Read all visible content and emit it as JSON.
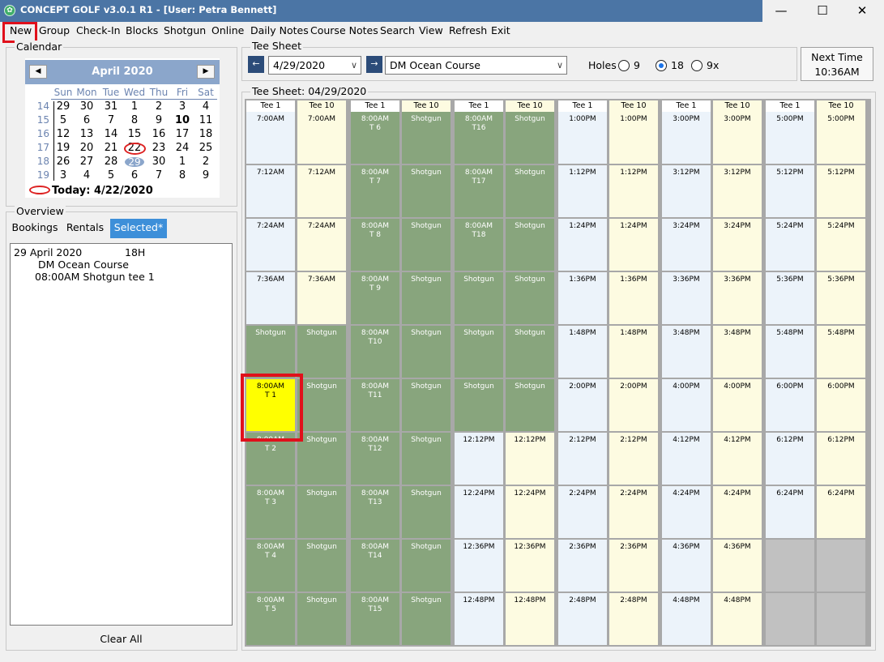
{
  "window": {
    "title": "CONCEPT GOLF v3.0.1 R1 - [User: Petra Bennett]",
    "app_icon": "golf-ball-icon",
    "controls": {
      "minimize": "—",
      "maximize": "☐",
      "close": "✕"
    }
  },
  "menu": [
    "New",
    "Group",
    "Check-In",
    "Blocks",
    "Shotgun",
    "Online",
    "Daily Notes",
    "Course Notes",
    "Search",
    "View",
    "Refresh",
    "Exit"
  ],
  "calendar": {
    "section_label": "Calendar",
    "month_label": "April 2020",
    "prev": "◀",
    "next": "▶",
    "dow": [
      "Sun",
      "Mon",
      "Tue",
      "Wed",
      "Thu",
      "Fri",
      "Sat"
    ],
    "weeks": [
      {
        "week": "14",
        "days": [
          "29",
          "30",
          "31",
          "1",
          "2",
          "3",
          "4"
        ]
      },
      {
        "week": "15",
        "days": [
          "5",
          "6",
          "7",
          "8",
          "9",
          "10",
          "11"
        ]
      },
      {
        "week": "16",
        "days": [
          "12",
          "13",
          "14",
          "15",
          "16",
          "17",
          "18"
        ]
      },
      {
        "week": "17",
        "days": [
          "19",
          "20",
          "21",
          "22",
          "23",
          "24",
          "25"
        ]
      },
      {
        "week": "18",
        "days": [
          "26",
          "27",
          "28",
          "29",
          "30",
          "1",
          "2"
        ]
      },
      {
        "week": "19",
        "days": [
          "3",
          "4",
          "5",
          "6",
          "7",
          "8",
          "9"
        ]
      }
    ],
    "today_label": "Today: 4/22/2020",
    "today_day": "22",
    "selected_day": "29",
    "bold_day": "10"
  },
  "overview": {
    "section_label": "Overview",
    "tabs": [
      "Bookings",
      "Rentals",
      "Selected*"
    ],
    "active_tab": "Selected*",
    "lines": [
      "29 April 2020",
      "18H",
      "DM Ocean Course",
      "08:00AM Shotgun tee 1"
    ],
    "clear_all": "Clear All"
  },
  "tee_sheet_header": {
    "section_label": "Tee Sheet",
    "prev_date": "←",
    "date": "4/29/2020",
    "next_date": "→",
    "course": "DM Ocean Course",
    "holes_label": "Holes",
    "holes_options": [
      "9",
      "18",
      "9x"
    ],
    "holes_selected": "18",
    "next_time_label": "Next Time",
    "next_time": "10:36AM"
  },
  "tee_sheet": {
    "label": "Tee Sheet: 04/29/2020",
    "colors": {
      "tee1": "#ecf3fa",
      "tee10": "#fdfbe1",
      "shotgun": "#88a57d",
      "empty": "#c1c1c1",
      "selected": "#ffff00"
    },
    "groups": [
      {
        "headers": [
          "Tee 1",
          "Tee 10"
        ],
        "rows": [
          [
            {
              "t": "7:00AM",
              "k": "tee1"
            },
            {
              "t": "7:00AM",
              "k": "tee10"
            }
          ],
          [
            {
              "t": "7:12AM",
              "k": "tee1"
            },
            {
              "t": "7:12AM",
              "k": "tee10"
            }
          ],
          [
            {
              "t": "7:24AM",
              "k": "tee1"
            },
            {
              "t": "7:24AM",
              "k": "tee10"
            }
          ],
          [
            {
              "t": "7:36AM",
              "k": "tee1"
            },
            {
              "t": "7:36AM",
              "k": "tee10"
            }
          ],
          [
            {
              "t": "Shotgun",
              "k": "shotgun"
            },
            {
              "t": "Shotgun",
              "k": "shotgun"
            }
          ],
          [
            {
              "t": "8:00AM\nT 1",
              "k": "selected"
            },
            {
              "t": "Shotgun",
              "k": "shotgun"
            }
          ],
          [
            {
              "t": "8:00AM\nT 2",
              "k": "shotgun"
            },
            {
              "t": "Shotgun",
              "k": "shotgun"
            }
          ],
          [
            {
              "t": "8:00AM\nT 3",
              "k": "shotgun"
            },
            {
              "t": "Shotgun",
              "k": "shotgun"
            }
          ],
          [
            {
              "t": "8:00AM\nT 4",
              "k": "shotgun"
            },
            {
              "t": "Shotgun",
              "k": "shotgun"
            }
          ],
          [
            {
              "t": "8:00AM\nT 5",
              "k": "shotgun"
            },
            {
              "t": "Shotgun",
              "k": "shotgun"
            }
          ]
        ]
      },
      {
        "headers": [
          "Tee 1",
          "Tee 10"
        ],
        "rows": [
          [
            {
              "t": "8:00AM\nT 6",
              "k": "shotgun"
            },
            {
              "t": "Shotgun",
              "k": "shotgun"
            }
          ],
          [
            {
              "t": "8:00AM\nT 7",
              "k": "shotgun"
            },
            {
              "t": "Shotgun",
              "k": "shotgun"
            }
          ],
          [
            {
              "t": "8:00AM\nT 8",
              "k": "shotgun"
            },
            {
              "t": "Shotgun",
              "k": "shotgun"
            }
          ],
          [
            {
              "t": "8:00AM\nT 9",
              "k": "shotgun"
            },
            {
              "t": "Shotgun",
              "k": "shotgun"
            }
          ],
          [
            {
              "t": "8:00AM\nT10",
              "k": "shotgun"
            },
            {
              "t": "Shotgun",
              "k": "shotgun"
            }
          ],
          [
            {
              "t": "8:00AM\nT11",
              "k": "shotgun"
            },
            {
              "t": "Shotgun",
              "k": "shotgun"
            }
          ],
          [
            {
              "t": "8:00AM\nT12",
              "k": "shotgun"
            },
            {
              "t": "Shotgun",
              "k": "shotgun"
            }
          ],
          [
            {
              "t": "8:00AM\nT13",
              "k": "shotgun"
            },
            {
              "t": "Shotgun",
              "k": "shotgun"
            }
          ],
          [
            {
              "t": "8:00AM\nT14",
              "k": "shotgun"
            },
            {
              "t": "Shotgun",
              "k": "shotgun"
            }
          ],
          [
            {
              "t": "8:00AM\nT15",
              "k": "shotgun"
            },
            {
              "t": "Shotgun",
              "k": "shotgun"
            }
          ]
        ]
      },
      {
        "headers": [
          "Tee 1",
          "Tee 10"
        ],
        "rows": [
          [
            {
              "t": "8:00AM\nT16",
              "k": "shotgun"
            },
            {
              "t": "Shotgun",
              "k": "shotgun"
            }
          ],
          [
            {
              "t": "8:00AM\nT17",
              "k": "shotgun"
            },
            {
              "t": "Shotgun",
              "k": "shotgun"
            }
          ],
          [
            {
              "t": "8:00AM\nT18",
              "k": "shotgun"
            },
            {
              "t": "Shotgun",
              "k": "shotgun"
            }
          ],
          [
            {
              "t": "Shotgun",
              "k": "shotgun"
            },
            {
              "t": "Shotgun",
              "k": "shotgun"
            }
          ],
          [
            {
              "t": "Shotgun",
              "k": "shotgun"
            },
            {
              "t": "Shotgun",
              "k": "shotgun"
            }
          ],
          [
            {
              "t": "Shotgun",
              "k": "shotgun"
            },
            {
              "t": "Shotgun",
              "k": "shotgun"
            }
          ],
          [
            {
              "t": "12:12PM",
              "k": "tee1"
            },
            {
              "t": "12:12PM",
              "k": "tee10"
            }
          ],
          [
            {
              "t": "12:24PM",
              "k": "tee1"
            },
            {
              "t": "12:24PM",
              "k": "tee10"
            }
          ],
          [
            {
              "t": "12:36PM",
              "k": "tee1"
            },
            {
              "t": "12:36PM",
              "k": "tee10"
            }
          ],
          [
            {
              "t": "12:48PM",
              "k": "tee1"
            },
            {
              "t": "12:48PM",
              "k": "tee10"
            }
          ]
        ]
      },
      {
        "headers": [
          "Tee 1",
          "Tee 10"
        ],
        "rows": [
          [
            {
              "t": "1:00PM",
              "k": "tee1"
            },
            {
              "t": "1:00PM",
              "k": "tee10"
            }
          ],
          [
            {
              "t": "1:12PM",
              "k": "tee1"
            },
            {
              "t": "1:12PM",
              "k": "tee10"
            }
          ],
          [
            {
              "t": "1:24PM",
              "k": "tee1"
            },
            {
              "t": "1:24PM",
              "k": "tee10"
            }
          ],
          [
            {
              "t": "1:36PM",
              "k": "tee1"
            },
            {
              "t": "1:36PM",
              "k": "tee10"
            }
          ],
          [
            {
              "t": "1:48PM",
              "k": "tee1"
            },
            {
              "t": "1:48PM",
              "k": "tee10"
            }
          ],
          [
            {
              "t": "2:00PM",
              "k": "tee1"
            },
            {
              "t": "2:00PM",
              "k": "tee10"
            }
          ],
          [
            {
              "t": "2:12PM",
              "k": "tee1"
            },
            {
              "t": "2:12PM",
              "k": "tee10"
            }
          ],
          [
            {
              "t": "2:24PM",
              "k": "tee1"
            },
            {
              "t": "2:24PM",
              "k": "tee10"
            }
          ],
          [
            {
              "t": "2:36PM",
              "k": "tee1"
            },
            {
              "t": "2:36PM",
              "k": "tee10"
            }
          ],
          [
            {
              "t": "2:48PM",
              "k": "tee1"
            },
            {
              "t": "2:48PM",
              "k": "tee10"
            }
          ]
        ]
      },
      {
        "headers": [
          "Tee 1",
          "Tee 10"
        ],
        "rows": [
          [
            {
              "t": "3:00PM",
              "k": "tee1"
            },
            {
              "t": "3:00PM",
              "k": "tee10"
            }
          ],
          [
            {
              "t": "3:12PM",
              "k": "tee1"
            },
            {
              "t": "3:12PM",
              "k": "tee10"
            }
          ],
          [
            {
              "t": "3:24PM",
              "k": "tee1"
            },
            {
              "t": "3:24PM",
              "k": "tee10"
            }
          ],
          [
            {
              "t": "3:36PM",
              "k": "tee1"
            },
            {
              "t": "3:36PM",
              "k": "tee10"
            }
          ],
          [
            {
              "t": "3:48PM",
              "k": "tee1"
            },
            {
              "t": "3:48PM",
              "k": "tee10"
            }
          ],
          [
            {
              "t": "4:00PM",
              "k": "tee1"
            },
            {
              "t": "4:00PM",
              "k": "tee10"
            }
          ],
          [
            {
              "t": "4:12PM",
              "k": "tee1"
            },
            {
              "t": "4:12PM",
              "k": "tee10"
            }
          ],
          [
            {
              "t": "4:24PM",
              "k": "tee1"
            },
            {
              "t": "4:24PM",
              "k": "tee10"
            }
          ],
          [
            {
              "t": "4:36PM",
              "k": "tee1"
            },
            {
              "t": "4:36PM",
              "k": "tee10"
            }
          ],
          [
            {
              "t": "4:48PM",
              "k": "tee1"
            },
            {
              "t": "4:48PM",
              "k": "tee10"
            }
          ]
        ]
      },
      {
        "headers": [
          "Tee 1",
          "Tee 10"
        ],
        "rows": [
          [
            {
              "t": "5:00PM",
              "k": "tee1"
            },
            {
              "t": "5:00PM",
              "k": "tee10"
            }
          ],
          [
            {
              "t": "5:12PM",
              "k": "tee1"
            },
            {
              "t": "5:12PM",
              "k": "tee10"
            }
          ],
          [
            {
              "t": "5:24PM",
              "k": "tee1"
            },
            {
              "t": "5:24PM",
              "k": "tee10"
            }
          ],
          [
            {
              "t": "5:36PM",
              "k": "tee1"
            },
            {
              "t": "5:36PM",
              "k": "tee10"
            }
          ],
          [
            {
              "t": "5:48PM",
              "k": "tee1"
            },
            {
              "t": "5:48PM",
              "k": "tee10"
            }
          ],
          [
            {
              "t": "6:00PM",
              "k": "tee1"
            },
            {
              "t": "6:00PM",
              "k": "tee10"
            }
          ],
          [
            {
              "t": "6:12PM",
              "k": "tee1"
            },
            {
              "t": "6:12PM",
              "k": "tee10"
            }
          ],
          [
            {
              "t": "6:24PM",
              "k": "tee1"
            },
            {
              "t": "6:24PM",
              "k": "tee10"
            }
          ],
          [
            {
              "t": "",
              "k": "empty"
            },
            {
              "t": "",
              "k": "empty"
            }
          ],
          [
            {
              "t": "",
              "k": "empty"
            },
            {
              "t": "",
              "k": "empty"
            }
          ]
        ]
      }
    ]
  }
}
